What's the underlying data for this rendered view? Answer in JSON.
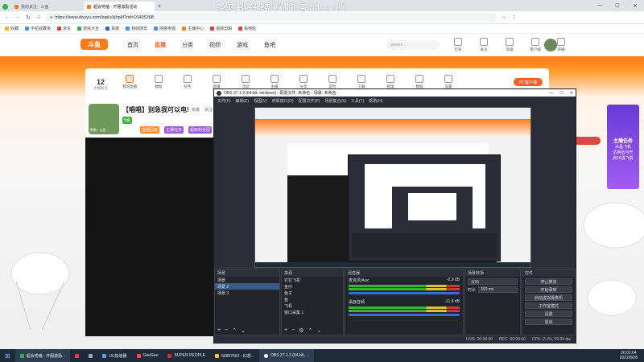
{
  "browser": {
    "tabs": [
      {
        "label": "我的关注 - 斗鱼",
        "active": false
      },
      {
        "label": "超会唠嗑 · 开服激励活动",
        "active": true
      }
    ],
    "url": "https://www.douyu.com/topic/cjhpkf?rid=10405398",
    "bookmarks": [
      "收藏",
      "手机收藏夹",
      "京东",
      "游戏大全",
      "百度",
      "我的网页",
      "网络电视",
      "主播中心",
      "视频剪辑",
      "看电影"
    ]
  },
  "watermark": "5级粉丝牌群聊请加vx群",
  "douyu": {
    "logo": "斗鱼",
    "nav": [
      "首页",
      "直播",
      "分类",
      "视频",
      "游戏",
      "鱼吧"
    ],
    "search_placeholder": "garees",
    "user_icons": [
      "历史",
      "关注",
      "等级",
      "客户端",
      "开播"
    ]
  },
  "room_card": {
    "fans_count": "12",
    "fans_label": "主播粉丝",
    "tools": [
      "我的直播",
      "数据",
      "任务",
      "直播",
      "活动",
      "主播",
      "分享",
      "定时",
      "下载",
      "管理",
      "数据",
      "设置"
    ],
    "pc_button": "PC客户端",
    "title": "【唱唱】别急我可以电!",
    "level_tag": "5级",
    "avatar_caption": "鸭鸭 · 公告",
    "tags": [
      "直播回放",
      "主播任务",
      "超级粉丝团"
    ],
    "follow": "关注",
    "report": "举报"
  },
  "right_banner": {
    "title": "主播任务",
    "lines": [
      "水晶飞机",
      "达到后可开",
      "启16强飞机"
    ]
  },
  "obs": {
    "title": "OBS 27.1.3 (64-bit, windows) - 配置文件: 未命名 - 场景: 未命名",
    "menu": [
      "文件(F)",
      "编辑(E)",
      "视图(V)",
      "停靠窗口(D)",
      "配置文件(P)",
      "场景集合(S)",
      "工具(T)",
      "帮助(H)"
    ],
    "scenes_header": "场景",
    "scenes": [
      "场景",
      "场景 2",
      "场景 3"
    ],
    "sources_header": "来源",
    "sources": [
      "钉钉飞机",
      "鱼仔",
      "鱼子",
      "鱼",
      "飞机",
      "窗口采集 1"
    ],
    "mixer_header": "混音器",
    "mixer": [
      {
        "name": "麦克风/Aux",
        "db": "-2.9 dB"
      },
      {
        "name": "桌面音频",
        "db": "-11.8 dB"
      }
    ],
    "transition_header": "场景转场",
    "transition_type": "淡出",
    "transition_duration_label": "时长",
    "transition_duration": "300 ms",
    "controls_header": "控件",
    "controls": [
      "停止推流",
      "开始录制",
      "启动虚拟摄像机",
      "工作室模式",
      "设置",
      "退出"
    ],
    "status": {
      "live": "LIVE: 00:00:00",
      "rec": "REC: 00:00:00",
      "cpu": "CPU: 2.1%, 59.94 fps"
    }
  },
  "taskbar": {
    "items": [
      "超会唠嗑 · 开服激励...",
      "UU加速器",
      "GeeGee",
      "SUPER PEOPLE",
      "56887562 - 幻想...",
      "OBS 27.1.3 (64-bit, ..."
    ],
    "time": "20:01:04",
    "date": "2022/8/28"
  }
}
